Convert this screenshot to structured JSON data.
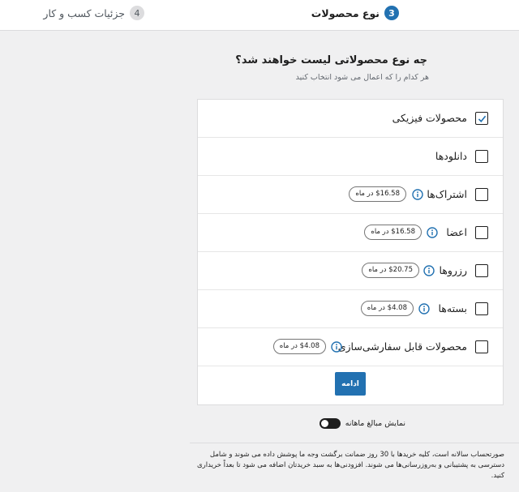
{
  "stepper": {
    "active": {
      "number": "3",
      "label": "نوع محصولات"
    },
    "next": {
      "number": "4",
      "label": "جزئیات کسب و کار"
    }
  },
  "question": {
    "title": "چه نوع محصولاتی لیست خواهند شد؟",
    "subtitle": "هر کدام را که اعمال می شود انتخاب کنید"
  },
  "product_types": [
    {
      "label": "محصولات فیزیکی",
      "checked": true,
      "price": ""
    },
    {
      "label": "دانلودها",
      "checked": false,
      "price": ""
    },
    {
      "label": "اشتراک‌ها",
      "checked": false,
      "price": "$16.58 در ماه"
    },
    {
      "label": "اعضا",
      "checked": false,
      "price": "$16.58 در ماه"
    },
    {
      "label": "رزروها",
      "checked": false,
      "price": "$20.75 در ماه"
    },
    {
      "label": "بسته‌ها",
      "checked": false,
      "price": "$4.08 در ماه"
    },
    {
      "label": "محصولات قابل سفارشی‌سازی",
      "checked": false,
      "price": "$4.08 در ماه"
    }
  ],
  "continue_label": "ادامه",
  "toggle": {
    "label": "نمایش مبالغ ماهانه",
    "on": true
  },
  "footer_note": "صورتحساب سالانه است، کلیه خریدها با 30 روز ضمانت برگشت وجه ما پوشش داده می شوند و شامل دسترسی به پشتیبانی و به‌روزرسانی‌ها می شوند. افزودنی‌ها به سبد خریدتان اضافه می شود تا بعداً خریداری کنید.",
  "colors": {
    "accent": "#2271b1",
    "text": "#1e1e1e",
    "muted": "#646970"
  }
}
